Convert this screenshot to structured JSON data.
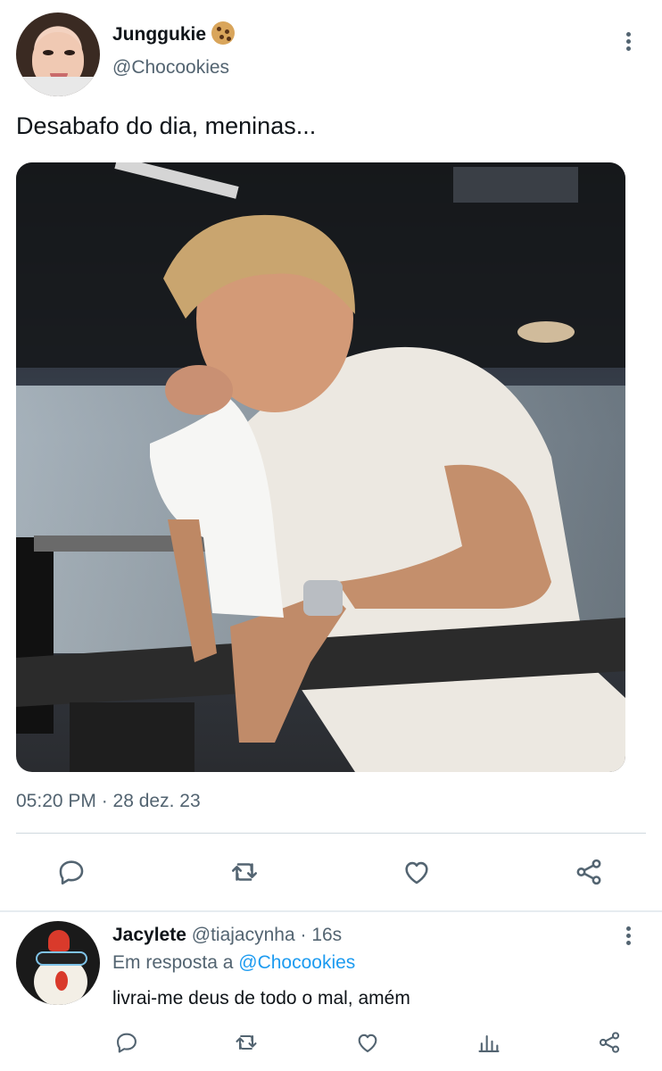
{
  "author": {
    "display_name": "Junggukie",
    "badge_icon": "cookie-icon",
    "handle": "@Chocookies"
  },
  "tweet": {
    "text": "Desabafo do dia, meninas...",
    "media_alt": "Photo of a man in a white t-shirt leaning on a gym bar holding a towel to his face",
    "timestamp": "05:20 PM · 28 dez. 23"
  },
  "actions": [
    {
      "icon": "reply-icon"
    },
    {
      "icon": "retweet-icon"
    },
    {
      "icon": "like-icon"
    },
    {
      "icon": "share-icon"
    }
  ],
  "reply": {
    "name": "Jacylete",
    "handle": "@tiajacynha",
    "time": "16s",
    "separator": "·",
    "replying_prefix": "Em resposta a",
    "replying_to": "@Chocookies",
    "text": "livrai-me deus de todo o mal, amém"
  },
  "reply_actions": [
    {
      "icon": "reply-icon"
    },
    {
      "icon": "retweet-icon"
    },
    {
      "icon": "like-icon"
    },
    {
      "icon": "analytics-icon"
    },
    {
      "icon": "share-icon"
    }
  ],
  "colors": {
    "text": "#0f1419",
    "secondary": "#536471",
    "accent": "#1d9bf0",
    "divider": "#cfd9de"
  }
}
